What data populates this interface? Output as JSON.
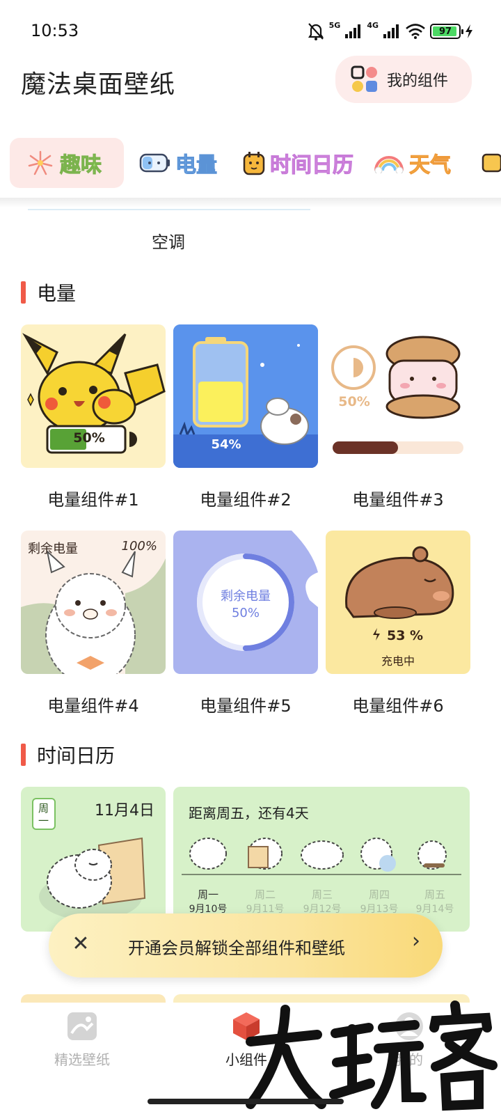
{
  "status": {
    "time": "10:53",
    "network1": "5G",
    "network2": "4G",
    "battery": "97"
  },
  "header": {
    "title": "魔法桌面壁纸",
    "my_widgets": "我的组件"
  },
  "tabs": [
    {
      "label": "趣味",
      "active": true
    },
    {
      "label": "电量",
      "active": false
    },
    {
      "label": "时间日历",
      "active": false
    },
    {
      "label": "天气",
      "active": false
    }
  ],
  "partial": {
    "caption": "空调"
  },
  "sections": {
    "power": {
      "title": "电量",
      "cards": [
        {
          "caption": "电量组件#1",
          "value": "50%",
          "level": 0.5
        },
        {
          "caption": "电量组件#2",
          "value": "54%",
          "level": 0.54
        },
        {
          "caption": "电量组件#3",
          "value": "50%",
          "level": 0.5
        },
        {
          "caption": "电量组件#4",
          "label": "剩余电量",
          "value": "100%",
          "level": 1.0
        },
        {
          "caption": "电量组件#5",
          "label": "剩余电量",
          "value": "50%",
          "level": 0.5
        },
        {
          "caption": "电量组件#6",
          "value": "53 %",
          "status": "充电中",
          "level": 0.53
        }
      ]
    },
    "calendar": {
      "title": "时间日历",
      "card1": {
        "weekday": "周一",
        "date": "11月4日"
      },
      "card2": {
        "headline": "距离周五，还有4天",
        "days": [
          {
            "name": "周一",
            "date": "9月10号"
          },
          {
            "name": "周二",
            "date": "9月11号"
          },
          {
            "name": "周三",
            "date": "9月12号"
          },
          {
            "name": "周四",
            "date": "9月13号"
          },
          {
            "name": "周五",
            "date": "9月14号"
          }
        ]
      }
    }
  },
  "vip_banner": {
    "text": "开通会员解锁全部组件和壁纸"
  },
  "bottom_nav": [
    {
      "label": "精选壁纸",
      "active": false
    },
    {
      "label": "小组件",
      "active": true
    },
    {
      "label": "我的",
      "active": false
    }
  ],
  "watermark": "大玩客",
  "colors": {
    "accent": "#f05a48",
    "tab_active_bg": "#fde9e7",
    "banner": "#fbe5a0"
  }
}
